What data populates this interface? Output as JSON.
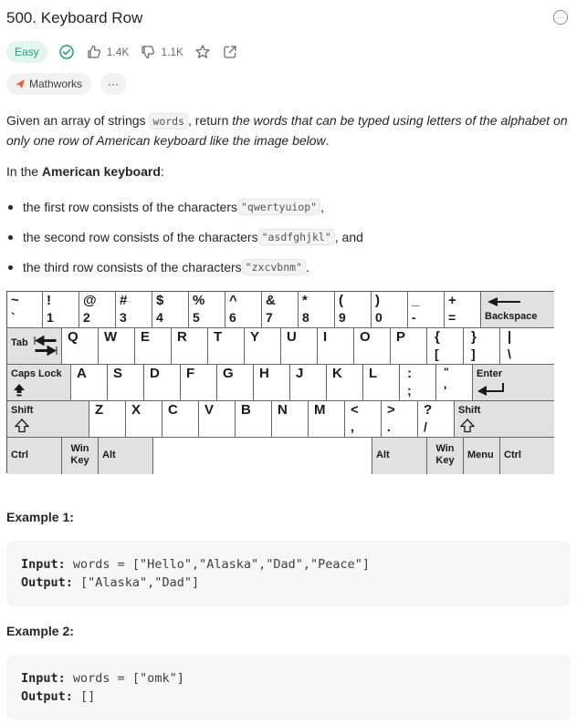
{
  "problem": {
    "title": "500. Keyboard Row",
    "difficulty": "Easy",
    "likes": "1.4K",
    "dislikes": "1.1K",
    "company_tag": "Mathworks",
    "more_tags": "···"
  },
  "description": {
    "p1_a": "Given an array of strings ",
    "p1_code": "words",
    "p1_b": ", return ",
    "p1_em": "the words that can be typed using letters of the alphabet on only one row of American keyboard like the image below",
    "p1_c": ".",
    "p2_a": "In the ",
    "p2_bold": "American keyboard",
    "p2_b": ":",
    "bullets": [
      {
        "text": "the first row consists of the characters ",
        "code": "\"qwertyuiop\"",
        "tail": ","
      },
      {
        "text": "the second row consists of the characters ",
        "code": "\"asdfghjkl\"",
        "tail": ", and"
      },
      {
        "text": "the third row consists of the characters ",
        "code": "\"zxcvbnm\"",
        "tail": "."
      }
    ]
  },
  "keyboard": {
    "row1": [
      {
        "t": "~",
        "b": "`"
      },
      {
        "t": "!",
        "b": "1"
      },
      {
        "t": "@",
        "b": "2"
      },
      {
        "t": "#",
        "b": "3"
      },
      {
        "t": "$",
        "b": "4"
      },
      {
        "t": "%",
        "b": "5"
      },
      {
        "t": "^",
        "b": "6"
      },
      {
        "t": "&",
        "b": "7"
      },
      {
        "t": "*",
        "b": "8"
      },
      {
        "t": "(",
        "b": "9"
      },
      {
        "t": ")",
        "b": "0"
      },
      {
        "t": "_",
        "b": "-"
      },
      {
        "t": "+",
        "b": "="
      }
    ],
    "backspace": "Backspace",
    "tab": "Tab",
    "row2": [
      "Q",
      "W",
      "E",
      "R",
      "T",
      "Y",
      "U",
      "I",
      "O",
      "P"
    ],
    "row2_sym": [
      {
        "t": "{",
        "b": "["
      },
      {
        "t": "}",
        "b": "]"
      },
      {
        "t": "|",
        "b": "\\"
      }
    ],
    "caps": "Caps Lock",
    "row3": [
      "A",
      "S",
      "D",
      "F",
      "G",
      "H",
      "J",
      "K",
      "L"
    ],
    "row3_sym": [
      {
        "t": ":",
        "b": ";"
      },
      {
        "t": "\"",
        "b": "'"
      }
    ],
    "enter": "Enter",
    "shift": "Shift",
    "row4": [
      "Z",
      "X",
      "C",
      "V",
      "B",
      "N",
      "M"
    ],
    "row4_sym": [
      {
        "t": "<",
        "b": ","
      },
      {
        "t": ">",
        "b": "."
      },
      {
        "t": "?",
        "b": "/"
      }
    ],
    "ctrl": "Ctrl",
    "win_key": "Win Key",
    "alt": "Alt",
    "menu": "Menu"
  },
  "examples": [
    {
      "label": "Example 1:",
      "input_label": "Input:",
      "input": " words = [\"Hello\",\"Alaska\",\"Dad\",\"Peace\"]",
      "output_label": "Output:",
      "output": " [\"Alaska\",\"Dad\"]"
    },
    {
      "label": "Example 2:",
      "input_label": "Input:",
      "input": " words = [\"omk\"]",
      "output_label": "Output:",
      "output": " []"
    }
  ]
}
